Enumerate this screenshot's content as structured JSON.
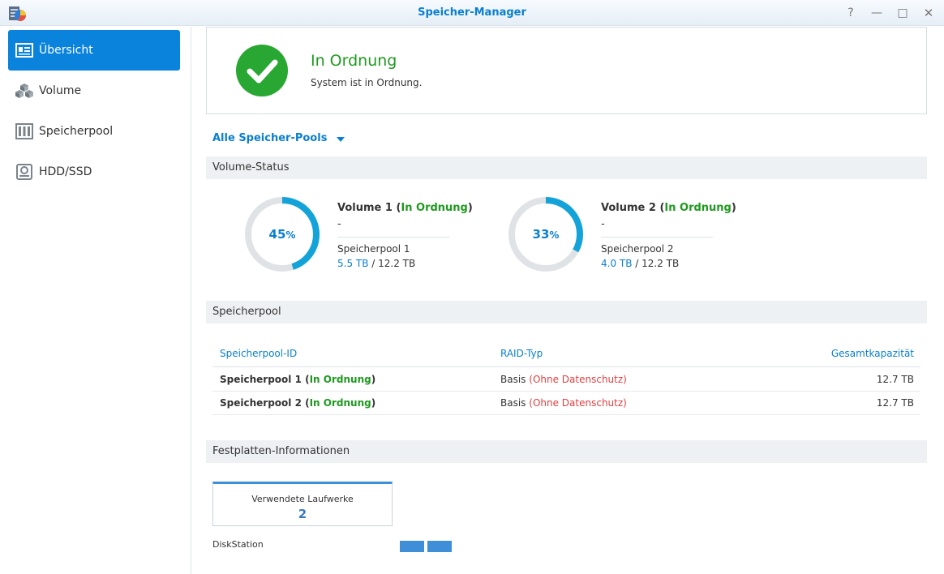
{
  "window": {
    "title": "Speicher-Manager",
    "help": "?",
    "minimize": "—",
    "maximize": "□",
    "close": "✕"
  },
  "sidebar": {
    "items": [
      {
        "label": "Übersicht",
        "icon": "overview-icon",
        "active": true
      },
      {
        "label": "Volume",
        "icon": "cubes-icon",
        "active": false
      },
      {
        "label": "Speicherpool",
        "icon": "storage-pool-icon",
        "active": false
      },
      {
        "label": "HDD/SSD",
        "icon": "hdd-icon",
        "active": false
      }
    ]
  },
  "status": {
    "title": "In Ordnung",
    "subtitle": "System ist in Ordnung.",
    "color": "#28a832"
  },
  "filter": {
    "label": "Alle Speicher-Pools"
  },
  "volume_section": {
    "title": "Volume-Status"
  },
  "volumes": [
    {
      "name": "Volume 1",
      "paren_open": " (",
      "status": "In Ordnung",
      "paren_close": ")",
      "dash": "-",
      "pool": "Speicherpool 1",
      "used": "5.5 TB",
      "sep": " / ",
      "total": "12.2 TB",
      "percent": 45,
      "percent_sign": "%"
    },
    {
      "name": "Volume 2",
      "paren_open": " (",
      "status": "In Ordnung",
      "paren_close": ")",
      "dash": "-",
      "pool": "Speicherpool 2",
      "used": "4.0 TB",
      "sep": " / ",
      "total": "12.2 TB",
      "percent": 33,
      "percent_sign": "%"
    }
  ],
  "pool_section": {
    "title": "Speicherpool"
  },
  "pool_table": {
    "headers": [
      "Speicherpool-ID",
      "RAID-Typ",
      "Gesamtkapazität"
    ],
    "rows": [
      {
        "name": "Speicherpool 1",
        "paren_open": " (",
        "status": "In Ordnung",
        "paren_close": ")",
        "raid": "Basis",
        "raid_note": "(Ohne Datenschutz)",
        "capacity": "12.7 TB"
      },
      {
        "name": "Speicherpool 2",
        "paren_open": " (",
        "status": "In Ordnung",
        "paren_close": ")",
        "raid": "Basis",
        "raid_note": "(Ohne Datenschutz)",
        "capacity": "12.7 TB"
      }
    ]
  },
  "disk_section": {
    "title": "Festplatten-Informationen"
  },
  "drives": {
    "label": "Verwendete Laufwerke",
    "count": "2"
  },
  "diskstation": {
    "label": "DiskStation",
    "bays": 2
  },
  "colors": {
    "accent": "#0a83dc",
    "ok": "#1e9a1e",
    "warn": "#e04040",
    "ring": "#e0e3e6",
    "ring_fill": "#14a3d9"
  }
}
